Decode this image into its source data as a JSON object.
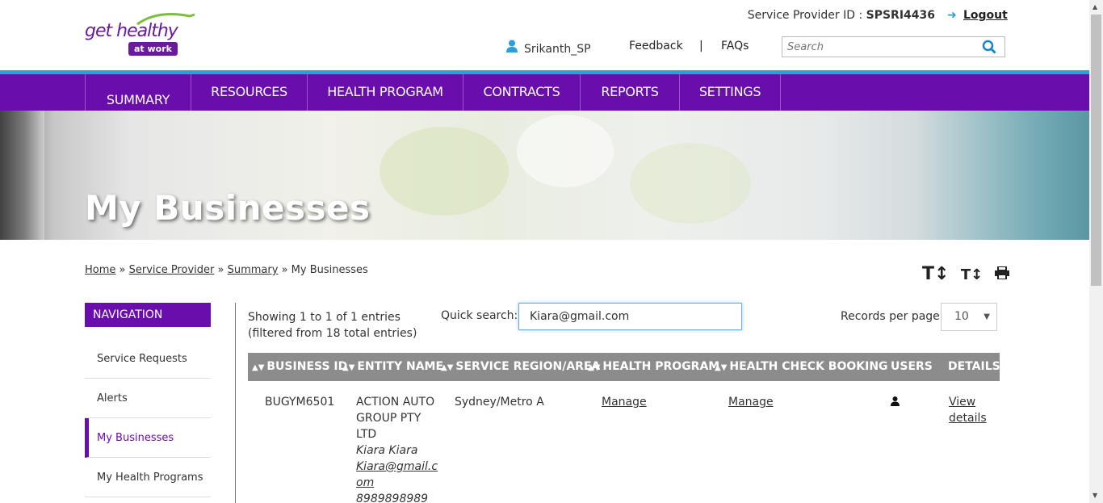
{
  "header": {
    "logo_text": "get healthy",
    "logo_badge": "at work",
    "sp_label": "Service Provider ID : ",
    "sp_id": "SPSRI4436",
    "logout": "Logout",
    "user": "Srikanth_SP",
    "feedback": "Feedback",
    "pipe": "|",
    "faqs": "FAQs",
    "search_placeholder": "Search"
  },
  "nav": {
    "items": [
      {
        "label": "SUMMARY"
      },
      {
        "label": "RESOURCES"
      },
      {
        "label": "HEALTH PROGRAM"
      },
      {
        "label": "CONTRACTS"
      },
      {
        "label": "REPORTS"
      },
      {
        "label": "SETTINGS"
      }
    ]
  },
  "banner": {
    "title": "My Businesses"
  },
  "breadcrumb": {
    "home": "Home",
    "sep": "»",
    "service_provider": "Service Provider",
    "summary": "Summary",
    "current": "My Businesses"
  },
  "tools": {
    "increase": "T↕",
    "decrease": "T↕",
    "print": "🖶"
  },
  "sidebar": {
    "heading": "NAVIGATION",
    "items": [
      {
        "label": "Service Requests"
      },
      {
        "label": "Alerts"
      },
      {
        "label": "My Businesses"
      },
      {
        "label": "My Health Programs"
      }
    ]
  },
  "list": {
    "showing_line1": "Showing 1 to 1 of 1 entries",
    "showing_line2": "(filtered from 18 total entries)",
    "quick_search_label": "Quick search:",
    "quick_search_value": "Kiara@gmail.com",
    "rpp_label": "Records per page",
    "rpp_value": "10"
  },
  "table": {
    "columns": [
      "BUSINESS ID",
      "ENTITY NAME",
      "SERVICE REGION/AREA",
      "HEALTH PROGRAM",
      "HEALTH CHECK BOOKING",
      "USERS",
      "DETAILS"
    ],
    "rows": [
      {
        "business_id": "BUGYM6501",
        "entity_line1": "ACTION AUTO",
        "entity_line2": "GROUP PTY",
        "entity_line3": "LTD",
        "contact_name": "Kiara Kiara",
        "contact_email_1": "Kiara@gmail.c",
        "contact_email_2": "om",
        "contact_phone": "8989898989",
        "region": "Sydney/Metro A",
        "health_program": "Manage",
        "health_check": "Manage",
        "details_1": "View",
        "details_2": "details"
      }
    ]
  },
  "colors": {
    "brand_purple": "#6a0dad",
    "accent_blue": "#2a9fd8",
    "table_header": "#8c8c8c"
  }
}
